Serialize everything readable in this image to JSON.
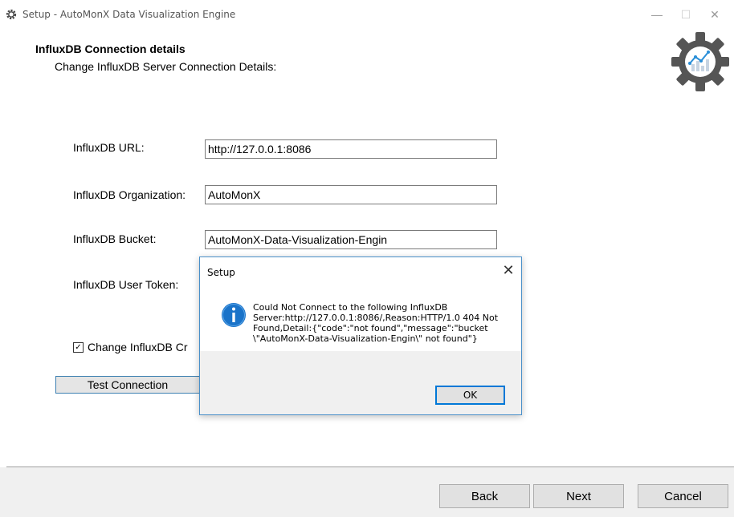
{
  "window": {
    "title": "Setup - AutoMonX Data Visualization Engine",
    "minimize": "—",
    "maximize": "☐",
    "close": "✕"
  },
  "header": {
    "title": "InfluxDB Connection details",
    "subtitle": "Change InfluxDB Server Connection Details:"
  },
  "form": {
    "url_label": "InfluxDB URL:",
    "url_value": "http://127.0.0.1:8086",
    "org_label": "InfluxDB Organization:",
    "org_value": "AutoMonX",
    "bucket_label": "InfluxDB Bucket:",
    "bucket_value": "AutoMonX-Data-Visualization-Engin",
    "token_label": "InfluxDB User Token:",
    "checkbox_label": "Change InfluxDB Cr",
    "checkbox_mark": "✓",
    "test_button": "Test Connection"
  },
  "footer": {
    "back": "Back",
    "next": "Next",
    "cancel": "Cancel"
  },
  "dialog": {
    "title": "Setup",
    "close": "✕",
    "icon": "info-icon",
    "message_lines": [
      "Could Not Connect to the following InfluxDB",
      "Server:http://127.0.0.1:8086/,Reason:HTTP/1.0 404 Not",
      "Found,Detail:{\"code\":\"not found\",\"message\":\"bucket",
      "\\\"AutoMonX-Data-Visualization-Engin\\\" not found\"}"
    ],
    "ok": "OK"
  },
  "colors": {
    "accent": "#0078d7",
    "info_icon": "#1a73c9",
    "logo": "#555555"
  }
}
